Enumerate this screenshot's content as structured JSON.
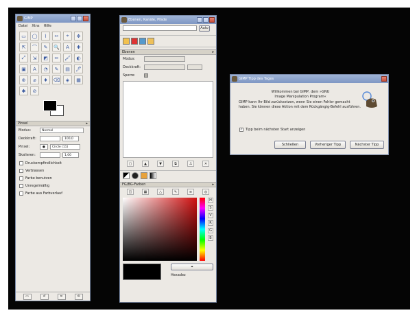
{
  "toolbox": {
    "title": "GIMP",
    "menu": [
      "Datei",
      "Xtns",
      "Hilfe"
    ],
    "tools": [
      "▭",
      "◯",
      "⌇",
      "✂",
      "⌖",
      "✥",
      "⇱",
      "⌒",
      "✎",
      "🔍",
      "A",
      "✚",
      "⤢",
      "⇲",
      "◩",
      "✏",
      "🖌",
      "◐",
      "▣",
      "A",
      "◔",
      "✎",
      "▤",
      "🖊",
      "⊕",
      "⌀",
      "♦",
      "⌫",
      "◈",
      "▦",
      "✱",
      "⊘"
    ],
    "options_title": "Pinsel",
    "mode_label": "Modus:",
    "mode_value": "Normal",
    "opacity_label": "Deckkraft:",
    "opacity_value": "100,0",
    "brush_label": "Pinsel:",
    "brush_value": "Circle (11)",
    "scale_label": "Skalieren:",
    "scale_value": "1,00",
    "checkboxes": [
      "Druckempfindlichkeit",
      "Verblassen",
      "Farbe benutzen",
      "Unregelmäßig",
      "Farbe aus Farbverlauf"
    ]
  },
  "dock": {
    "title": "Ebenen, Kanäle, Pfade",
    "auto_button": "Auto",
    "layers_title": "Ebenen",
    "mode_label": "Modus:",
    "opacity_label": "Deckkraft:",
    "lock_label": "Sperre:",
    "colors_title": "FG/BG-Farben",
    "hex_label": "Hexadez"
  },
  "tip_dialog": {
    "title": "GIMP Tipp des Tages",
    "heading_1": "Willkommen bei GIMP, dem »GNU",
    "heading_2": "Image Manipulation Program«",
    "body": "GIMP kann Ihr Bild zurücksetzen, wenn Sie einen Fehler gemacht haben. Sie können diese Aktion mit dem Rückgängig-Befehl ausführen.",
    "checkbox_label": "Tipp beim nächsten Start anzeigen",
    "btn_close": "Schließen",
    "btn_prev": "Vorheriger Tipp",
    "btn_next": "Nächster Tipp"
  },
  "colors": {
    "desktop": "#050505",
    "window_bg": "#ece9e4",
    "titlebar": "#8aa0cc"
  }
}
